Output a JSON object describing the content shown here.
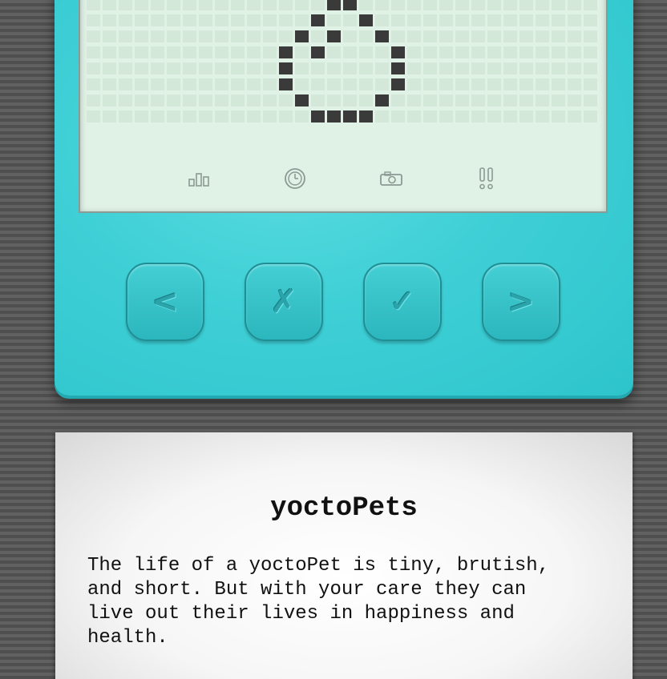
{
  "device": {
    "screen": {
      "pet_icon": "yoctopet-egg-sprite",
      "status_icons": [
        {
          "name": "stats-icon",
          "glyph": "bars"
        },
        {
          "name": "clock-icon",
          "glyph": "clock"
        },
        {
          "name": "camera-icon",
          "glyph": "camera"
        },
        {
          "name": "alert-icon",
          "glyph": "double-exclamation"
        }
      ]
    },
    "buttons": {
      "prev": "<",
      "cancel": "✗",
      "confirm": "✓",
      "next": ">"
    },
    "colors": {
      "body": "#3fd0d6",
      "screen": "#e0f1e5",
      "pixel_on": "#3a3a3a"
    }
  },
  "info": {
    "title": "yoctoPets",
    "body": "The life of a yoctoPet is tiny, brutish,\nand short. But with your care they can\nlive out their lives in happiness and\nhealth."
  }
}
